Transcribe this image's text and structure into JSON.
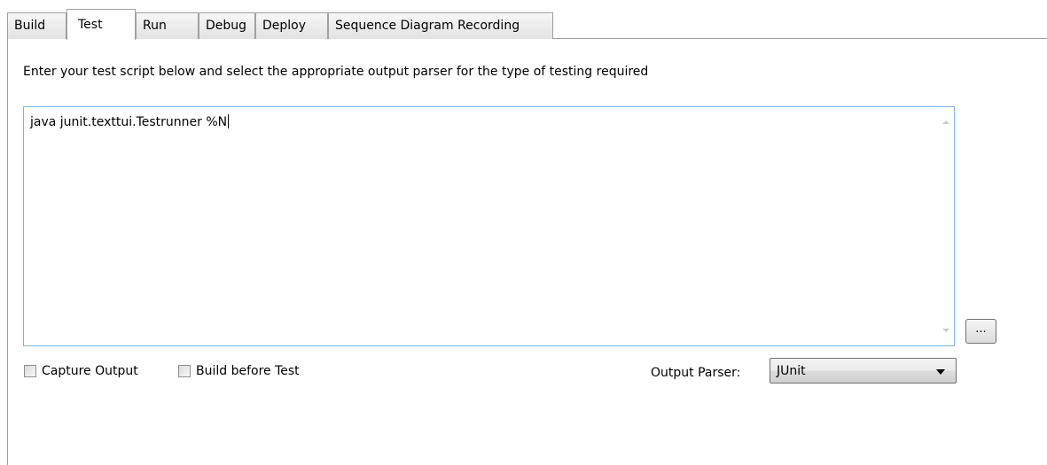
{
  "tabs": [
    {
      "label": "Build"
    },
    {
      "label": "Test"
    },
    {
      "label": "Run"
    },
    {
      "label": "Debug"
    },
    {
      "label": "Deploy"
    },
    {
      "label": "Sequence Diagram Recording"
    }
  ],
  "active_tab": "Test",
  "instructions": "Enter your test script below and select the appropriate output parser for the type of testing required",
  "script": {
    "value": "java junit.texttui.Testrunner %N"
  },
  "browse_button": {
    "label": "..."
  },
  "options": {
    "capture_output": {
      "label": "Capture Output",
      "checked": false
    },
    "build_before_test": {
      "label": "Build before Test",
      "checked": false
    }
  },
  "output_parser": {
    "label": "Output Parser:",
    "selected": "JUnit"
  },
  "icons": {
    "scroll_up": "scroll-up-arrow",
    "scroll_down": "scroll-down-arrow",
    "dropdown": "chevron-down"
  },
  "colors": {
    "textarea_border": "#7eb4ea",
    "tab_border": "#a0a0a0"
  }
}
